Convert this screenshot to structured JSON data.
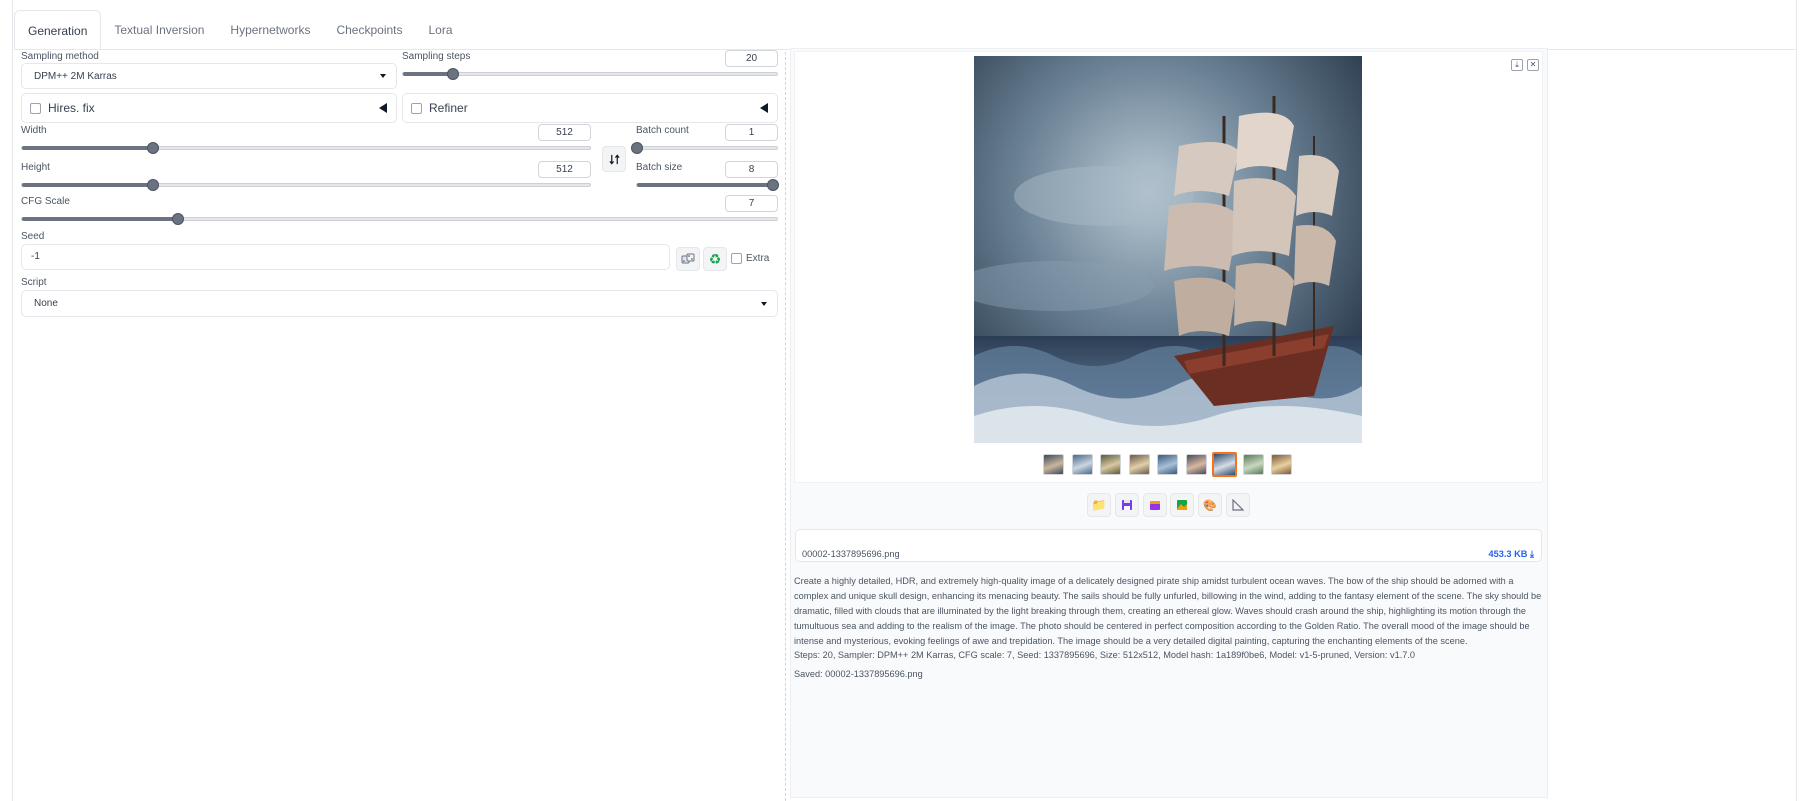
{
  "tabs": [
    "Generation",
    "Textual Inversion",
    "Hypernetworks",
    "Checkpoints",
    "Lora"
  ],
  "sampling_method": {
    "label": "Sampling method",
    "value": "DPM++ 2M Karras"
  },
  "sampling_steps": {
    "label": "Sampling steps",
    "value": "20",
    "fraction": 0.134
  },
  "hires_fix": {
    "label": "Hires. fix",
    "checked": false
  },
  "refiner": {
    "label": "Refiner",
    "checked": false
  },
  "width": {
    "label": "Width",
    "value": "512",
    "fraction": 0.231
  },
  "height": {
    "label": "Height",
    "value": "512",
    "fraction": 0.231
  },
  "batch_count": {
    "label": "Batch count",
    "value": "1",
    "fraction": 0.0
  },
  "batch_size": {
    "label": "Batch size",
    "value": "8",
    "fraction": 1.0
  },
  "cfg_scale": {
    "label": "CFG Scale",
    "value": "7",
    "fraction": 0.207
  },
  "seed": {
    "label": "Seed",
    "value": "-1",
    "extra_label": "Extra"
  },
  "script": {
    "label": "Script",
    "value": "None"
  },
  "output": {
    "filename": "00002-1337895696.png",
    "filesize": "453.3 KB",
    "thumbnail_count": 9,
    "selected_thumbnail": 6,
    "prompt": "Create a highly detailed, HDR, and extremely high-quality image of a delicately designed pirate ship amidst turbulent ocean waves. The bow of the ship should be adorned with a complex and unique skull design, enhancing its menacing beauty. The sails should be fully unfurled, billowing in the wind, adding to the fantasy element of the scene. The sky should be dramatic, filled with clouds that are illuminated by the light breaking through them, creating an ethereal glow. Waves should crash around the ship, highlighting its motion through the tumultuous sea and adding to the realism of the image. The photo should be centered in perfect composition according to the Golden Ratio. The overall mood of the image should be intense and mysterious, evoking feelings of awe and trepidation. The image should be a very detailed digital painting, capturing the enchanting elements of the scene.",
    "params": "Steps: 20, Sampler: DPM++ 2M Karras, CFG scale: 7, Seed: 1337895696, Size: 512x512, Model hash: 1a189f0be6, Model: v1-5-pruned, Version: v1.7.0",
    "saved": "Saved: 00002-1337895696.png"
  },
  "icons": {
    "swap": "swap-dimensions-icon",
    "random": "dice-icon",
    "reuse": "recycle-icon",
    "actions": [
      "folder-icon",
      "save-icon",
      "zip-icon",
      "image-icon",
      "palette-icon",
      "ruler-icon"
    ]
  },
  "colors": {
    "accent": "#f97316",
    "link": "#2563eb",
    "slider": "#6b7280",
    "recycle": "#16a34a"
  }
}
